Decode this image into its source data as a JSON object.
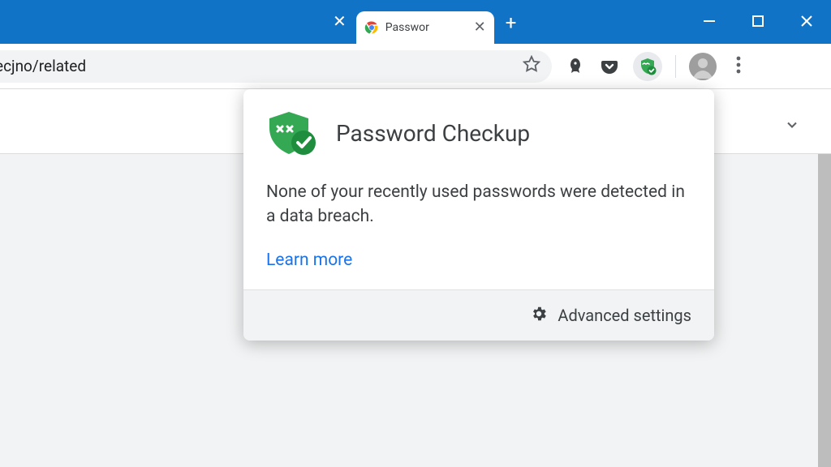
{
  "window": {
    "active_tab_title": "Passwor",
    "address_fragment": "ecjno/related"
  },
  "icons": {
    "star": "star",
    "rocket": "rocket",
    "pocket": "pocket",
    "password_checkup": "shield-check",
    "avatar": "user-photo",
    "menu": "kebab"
  },
  "popup": {
    "title": "Password Checkup",
    "body": "None of your recently used passwords were detected in a data breach.",
    "learn_more": "Learn more",
    "advanced": "Advanced settings"
  },
  "colors": {
    "title_bar": "#1073c6",
    "accent_green": "#34a853",
    "link": "#1a73e8"
  }
}
